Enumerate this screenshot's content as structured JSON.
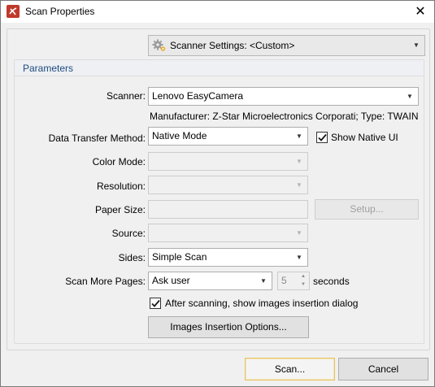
{
  "window": {
    "title": "Scan Properties",
    "close_glyph": "✕"
  },
  "scanner_settings": {
    "label": "Scanner Settings:",
    "value": "<Custom>"
  },
  "group": {
    "title": "Parameters"
  },
  "fields": {
    "scanner": {
      "label": "Scanner:",
      "value": "Lenovo EasyCamera"
    },
    "manufacturer_info": "Manufacturer: Z-Star Microelectronics Corporati; Type: TWAIN",
    "data_transfer": {
      "label": "Data Transfer Method:",
      "value": "Native Mode"
    },
    "show_native_ui": {
      "label": "Show Native UI",
      "checked": true
    },
    "color_mode": {
      "label": "Color Mode:",
      "value": ""
    },
    "resolution": {
      "label": "Resolution:",
      "value": ""
    },
    "paper_size": {
      "label": "Paper Size:",
      "value": ""
    },
    "setup_button": "Setup...",
    "source": {
      "label": "Source:",
      "value": ""
    },
    "sides": {
      "label": "Sides:",
      "value": "Simple Scan"
    },
    "scan_more_pages": {
      "label": "Scan More Pages:",
      "value": "Ask user"
    },
    "seconds_value": "5",
    "seconds_label": "seconds",
    "after_scanning": {
      "label": "After scanning, show images insertion dialog",
      "checked": true
    },
    "images_insertion_button": "Images Insertion Options..."
  },
  "footer": {
    "scan_button": "Scan...",
    "cancel_button": "Cancel"
  },
  "icons": {
    "app": "pdf-app-icon",
    "settings": "gear-icon",
    "dropdown": "chevron-down-icon",
    "check": "check-icon"
  }
}
